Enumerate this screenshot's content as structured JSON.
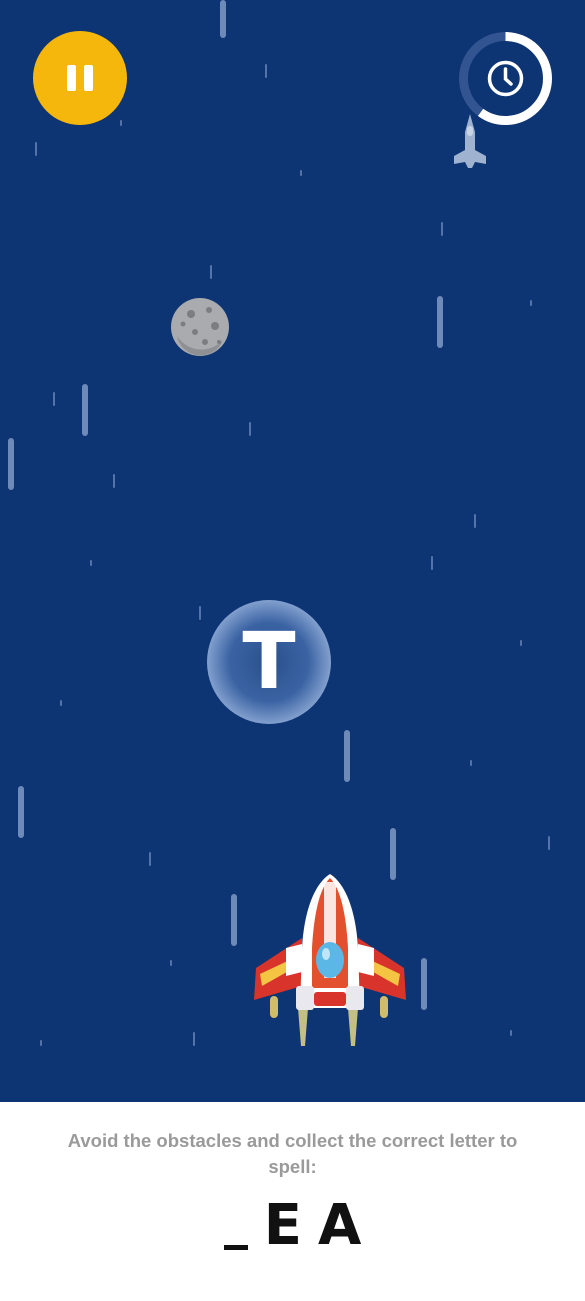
{
  "game": {
    "collectible_letter": "T",
    "timer_progress": 0.6
  },
  "instruction": {
    "text": "Avoid the obstacles and collect the correct letter to spell:"
  },
  "word": {
    "letters": [
      "_",
      "E",
      "A"
    ]
  },
  "colors": {
    "background": "#0d3473",
    "pause_button": "#f6b70c",
    "panel": "#ffffff"
  }
}
